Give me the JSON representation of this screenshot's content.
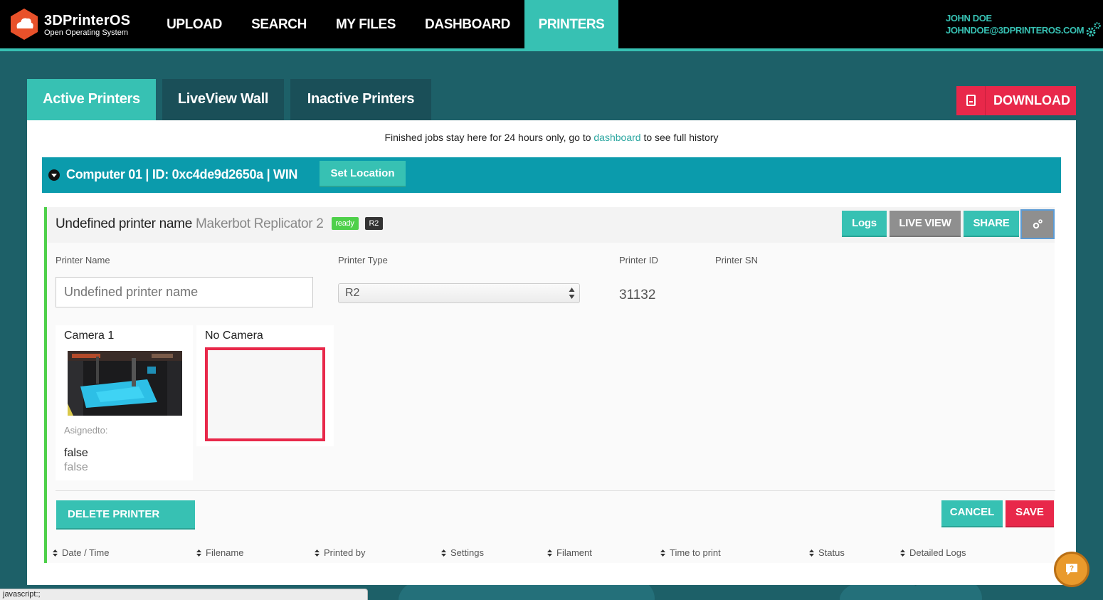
{
  "app": {
    "title": "3DPrinterOS",
    "subtitle": "Open Operating System"
  },
  "nav": {
    "items": [
      {
        "label": "UPLOAD"
      },
      {
        "label": "SEARCH"
      },
      {
        "label": "MY FILES"
      },
      {
        "label": "DASHBOARD"
      },
      {
        "label": "PRINTERS",
        "active": true
      }
    ]
  },
  "user": {
    "name": "JOHN DOE",
    "email": "JOHNDOE@3DPRINTEROS.COM"
  },
  "tabs": [
    {
      "label": "Active Printers",
      "active": true
    },
    {
      "label": "LiveView Wall"
    },
    {
      "label": "Inactive Printers"
    }
  ],
  "download": {
    "label": "DOWNLOAD"
  },
  "notice": {
    "before": "Finished jobs stay here for 24 hours only, go to",
    "link": "dashboard",
    "after": "to see full history"
  },
  "computer": {
    "title": "Computer 01 | ID: 0xc4de9d2650a | WIN",
    "set_location": "Set Location"
  },
  "printer": {
    "name": "Undefined printer name",
    "model": "Makerbot Replicator 2",
    "status": "ready",
    "type_badge": "R2",
    "buttons": {
      "logs": "Logs",
      "live_view": "LIVE VIEW",
      "share": "SHARE"
    },
    "fields": {
      "name_label": "Printer Name",
      "name_placeholder": "Undefined printer name",
      "type_label": "Printer Type",
      "type_value": "R2",
      "id_label": "Printer ID",
      "id_value": "31132",
      "sn_label": "Printer SN"
    },
    "cameras": [
      {
        "title": "Camera 1",
        "assigned_label": "Asignedto:",
        "value1": "false",
        "value2": "false"
      },
      {
        "title": "No Camera"
      }
    ],
    "actions": {
      "delete": "DELETE PRINTER",
      "cancel": "CANCEL",
      "save": "SAVE"
    },
    "table_columns": [
      "Date / Time",
      "Filename",
      "Printed by",
      "Settings",
      "Filament",
      "Time to print",
      "Status",
      "Detailed Logs"
    ]
  },
  "status_bar": "javascript:;",
  "colors": {
    "accent": "#37c1b3",
    "danger": "#e8284a",
    "computer_bar": "#0b9bac",
    "background": "#1d6068",
    "ready": "#4ed04a"
  }
}
